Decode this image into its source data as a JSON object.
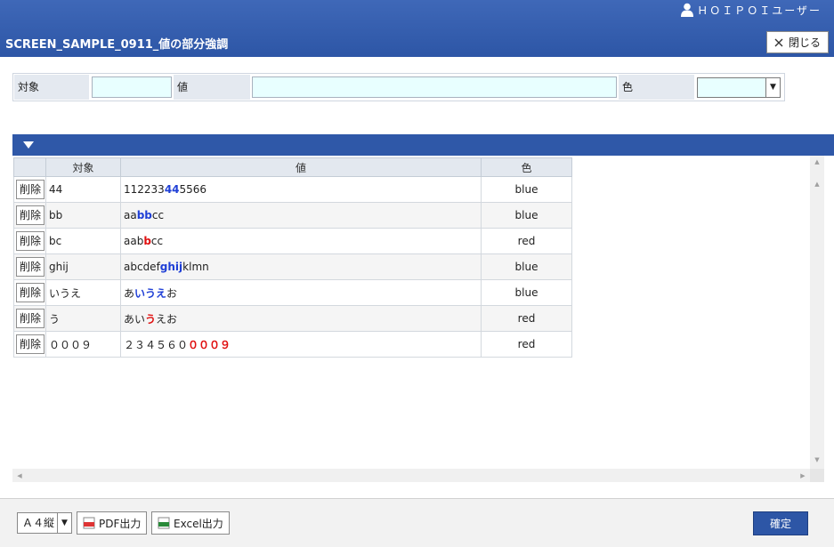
{
  "header": {
    "user_name": "ＨＯＩＰＯＩユーザー",
    "screen_title": "SCREEN_SAMPLE_0911_値の部分強調",
    "close_label": "閉じる"
  },
  "search": {
    "target_label": "対象",
    "target_value": "",
    "value_label": "値",
    "value_value": "",
    "color_label": "色",
    "color_value": ""
  },
  "table": {
    "columns": [
      "",
      "対象",
      "値",
      "色"
    ],
    "delete_label": "削除",
    "rows": [
      {
        "target": "44",
        "value_parts": [
          {
            "t": "112233",
            "hl": ""
          },
          {
            "t": "44",
            "hl": "blue"
          },
          {
            "t": "5566",
            "hl": ""
          }
        ],
        "color": "blue"
      },
      {
        "target": "bb",
        "value_parts": [
          {
            "t": "aa",
            "hl": ""
          },
          {
            "t": "bb",
            "hl": "blue"
          },
          {
            "t": "cc",
            "hl": ""
          }
        ],
        "color": "blue"
      },
      {
        "target": "bc",
        "value_parts": [
          {
            "t": "aab",
            "hl": ""
          },
          {
            "t": "b",
            "hl": "red"
          },
          {
            "t": "cc",
            "hl": ""
          }
        ],
        "color": "red"
      },
      {
        "target": "ghij",
        "value_parts": [
          {
            "t": "abcdef",
            "hl": ""
          },
          {
            "t": "ghij",
            "hl": "blue"
          },
          {
            "t": "klmn",
            "hl": ""
          }
        ],
        "color": "blue"
      },
      {
        "target": "いうえ",
        "value_parts": [
          {
            "t": "あ",
            "hl": ""
          },
          {
            "t": "いうえ",
            "hl": "blue"
          },
          {
            "t": "お",
            "hl": ""
          }
        ],
        "color": "blue"
      },
      {
        "target": "う",
        "value_parts": [
          {
            "t": "あい",
            "hl": ""
          },
          {
            "t": "う",
            "hl": "red"
          },
          {
            "t": "えお",
            "hl": ""
          }
        ],
        "color": "red"
      },
      {
        "target": "０００９",
        "value_parts": [
          {
            "t": "２３４５６０",
            "hl": ""
          },
          {
            "t": "０００９",
            "hl": "red"
          }
        ],
        "color": "red"
      }
    ]
  },
  "footer": {
    "paper_size": "Ａ４縦",
    "pdf_label": "PDF出力",
    "excel_label": "Excel出力",
    "confirm_label": "確定"
  },
  "colors": {
    "header_bg": "#2d56a6",
    "highlight_blue": "#1f3fd6",
    "highlight_red": "#e01010",
    "input_bg": "#e8ffff"
  }
}
